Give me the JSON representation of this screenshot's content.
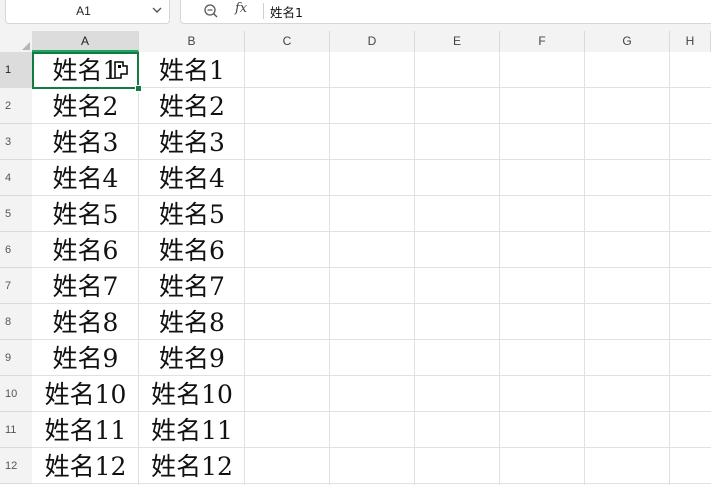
{
  "name_box": {
    "value": "A1"
  },
  "formula_bar": {
    "fx_label": "fx",
    "content": "姓名1"
  },
  "columns": [
    "A",
    "B",
    "C",
    "D",
    "E",
    "F",
    "G",
    "H"
  ],
  "selected_cell": "A1",
  "rows": [
    {
      "n": "1",
      "a": "姓名1",
      "b": "姓名1"
    },
    {
      "n": "2",
      "a": "姓名2",
      "b": "姓名2"
    },
    {
      "n": "3",
      "a": "姓名3",
      "b": "姓名3"
    },
    {
      "n": "4",
      "a": "姓名4",
      "b": "姓名4"
    },
    {
      "n": "5",
      "a": "姓名5",
      "b": "姓名5"
    },
    {
      "n": "6",
      "a": "姓名6",
      "b": "姓名6"
    },
    {
      "n": "7",
      "a": "姓名7",
      "b": "姓名7"
    },
    {
      "n": "8",
      "a": "姓名8",
      "b": "姓名8"
    },
    {
      "n": "9",
      "a": "姓名9",
      "b": "姓名9"
    },
    {
      "n": "10",
      "a": "姓名10",
      "b": "姓名10"
    },
    {
      "n": "11",
      "a": "姓名11",
      "b": "姓名11"
    },
    {
      "n": "12",
      "a": "姓名12",
      "b": "姓名12"
    }
  ]
}
